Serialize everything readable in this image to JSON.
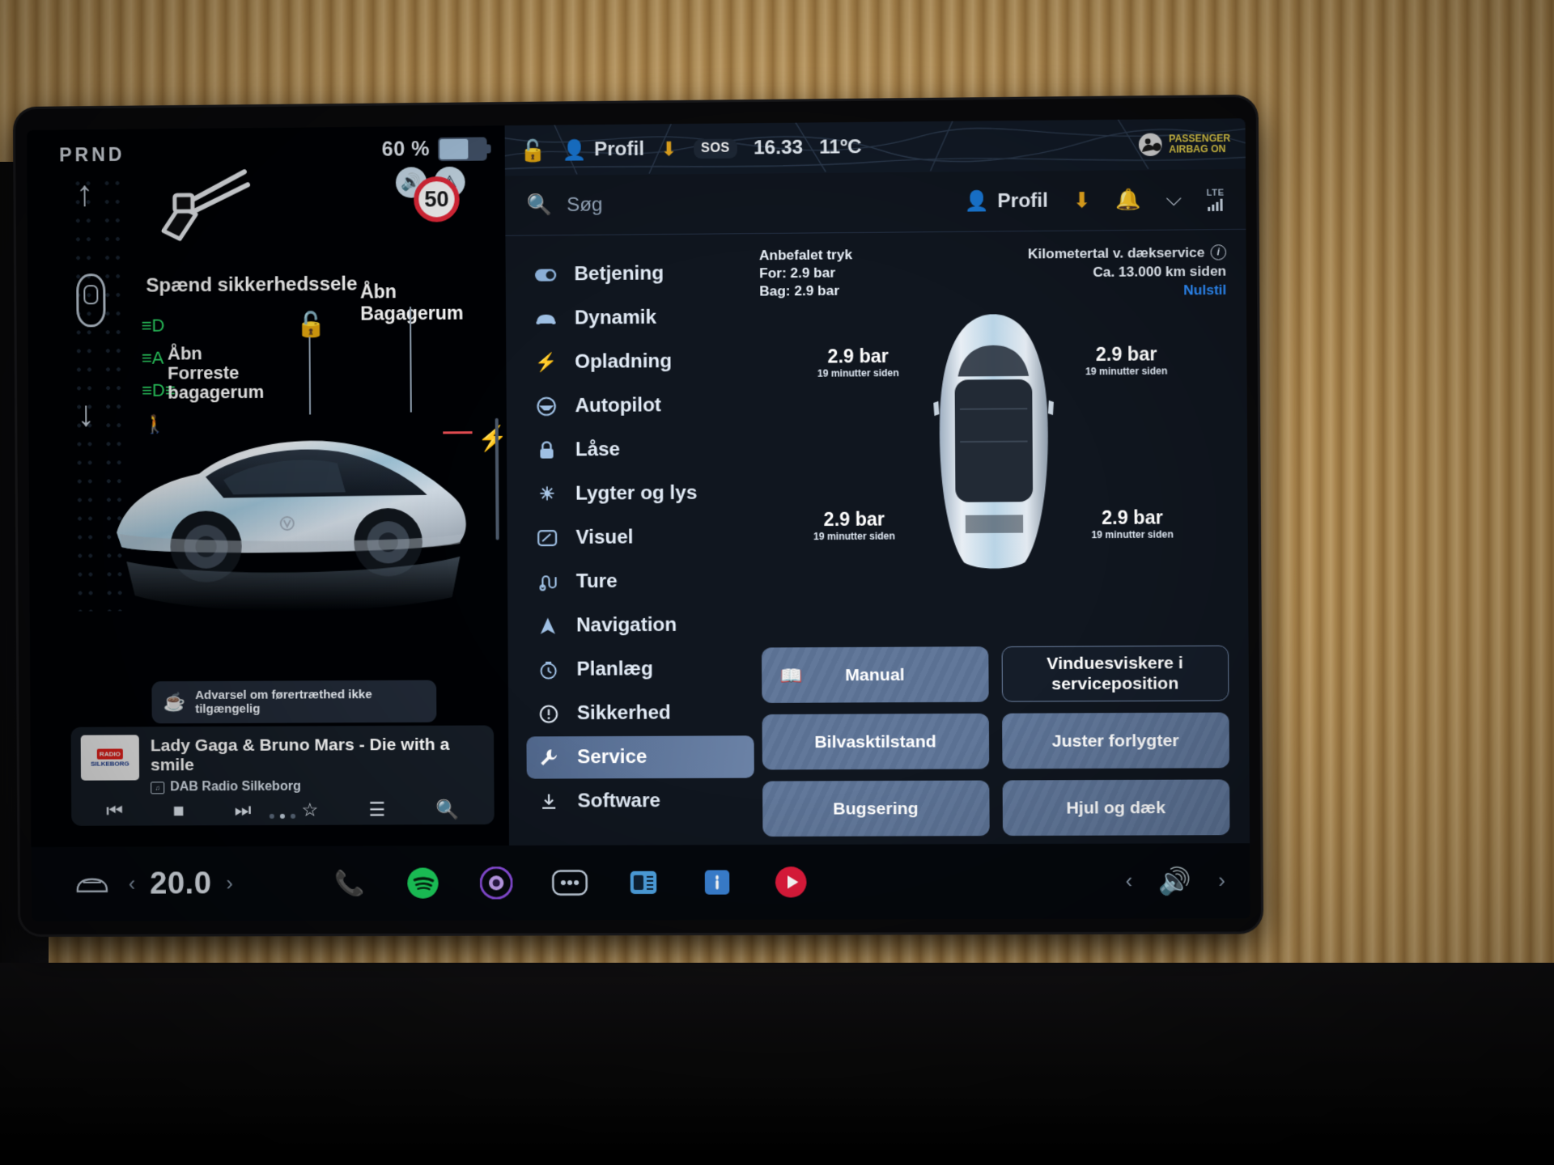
{
  "left_panel": {
    "gear_indicator": "PRND",
    "battery_percent": "60 %",
    "speed_limit": "50",
    "seatbelt_warning": "Spænd sikkerhedssele",
    "front_trunk_label": "Åbn\nForreste\nbagagerum",
    "rear_trunk_label": "Åbn\nBagagerum",
    "drowsiness_toast": "Advarsel om førertræthed ikke tilgængelig",
    "media": {
      "track_title": "Lady Gaga & Bruno Mars - Die with a smile",
      "source": "DAB Radio Silkeborg",
      "album_line1": "RADIO",
      "album_line2": "SILKEBORG",
      "controls": [
        "previous-track",
        "stop",
        "next-track",
        "favorite",
        "equalizer",
        "search"
      ]
    }
  },
  "top_bar": {
    "lock_state": "unlocked",
    "profile_label": "Profil",
    "download_icon": "download-icon",
    "sos_label": "SOS",
    "time": "16.33",
    "temperature": "11ºC",
    "airbag_line1": "PASSENGER",
    "airbag_line2": "AIRBAG ON"
  },
  "search": {
    "placeholder": "Søg",
    "profile_label": "Profil",
    "connectivity_label": "LTE"
  },
  "menu": {
    "items": [
      {
        "label": "Betjening",
        "icon": "toggle-icon",
        "active": false
      },
      {
        "label": "Dynamik",
        "icon": "car-front-icon",
        "active": false
      },
      {
        "label": "Opladning",
        "icon": "bolt-icon",
        "active": false
      },
      {
        "label": "Autopilot",
        "icon": "steering-icon",
        "active": false
      },
      {
        "label": "Låse",
        "icon": "lock-icon",
        "active": false
      },
      {
        "label": "Lygter og lys",
        "icon": "light-icon",
        "active": false
      },
      {
        "label": "Visuel",
        "icon": "display-icon",
        "active": false
      },
      {
        "label": "Ture",
        "icon": "trip-icon",
        "active": false
      },
      {
        "label": "Navigation",
        "icon": "navigation-icon",
        "active": false
      },
      {
        "label": "Planlæg",
        "icon": "schedule-icon",
        "active": false
      },
      {
        "label": "Sikkerhed",
        "icon": "safety-icon",
        "active": false
      },
      {
        "label": "Service",
        "icon": "wrench-icon",
        "active": true
      },
      {
        "label": "Software",
        "icon": "download-icon",
        "active": false
      }
    ]
  },
  "service": {
    "recommended": {
      "title": "Anbefalet tryk",
      "front": "For: 2.9 bar",
      "rear": "Bag: 2.9 bar"
    },
    "odometer": {
      "title": "Kilometertal v. dækservice",
      "value": "Ca. 13.000 km siden",
      "reset_label": "Nulstil"
    },
    "tires": [
      {
        "position": "front-left",
        "pressure": "2.9 bar",
        "updated": "19 minutter siden"
      },
      {
        "position": "front-right",
        "pressure": "2.9 bar",
        "updated": "19 minutter siden"
      },
      {
        "position": "rear-left",
        "pressure": "2.9 bar",
        "updated": "19 minutter siden"
      },
      {
        "position": "rear-right",
        "pressure": "2.9 bar",
        "updated": "19 minutter siden"
      }
    ],
    "buttons": [
      {
        "label": "Manual",
        "icon": "book-icon",
        "style": "filled"
      },
      {
        "label": "Vinduesviskere i serviceposition",
        "icon": "",
        "style": "outline"
      },
      {
        "label": "Bilvasktilstand",
        "icon": "",
        "style": "filled"
      },
      {
        "label": "Juster forlygter",
        "icon": "",
        "style": "filled"
      },
      {
        "label": "Bugsering",
        "icon": "",
        "style": "filled"
      },
      {
        "label": "Hjul og dæk",
        "icon": "",
        "style": "filled"
      }
    ]
  },
  "bottom_bar": {
    "climate_temp": "20.0",
    "apps": [
      "phone-icon",
      "spotify-icon",
      "camera-icon",
      "more-icon",
      "calendar-icon",
      "info-icon",
      "media-icon"
    ]
  },
  "colors": {
    "accent_blue": "#2f8fff",
    "warning_red": "#e3293a",
    "airbag_yellow": "#e8d24a",
    "button_fill": "#5b7193"
  }
}
